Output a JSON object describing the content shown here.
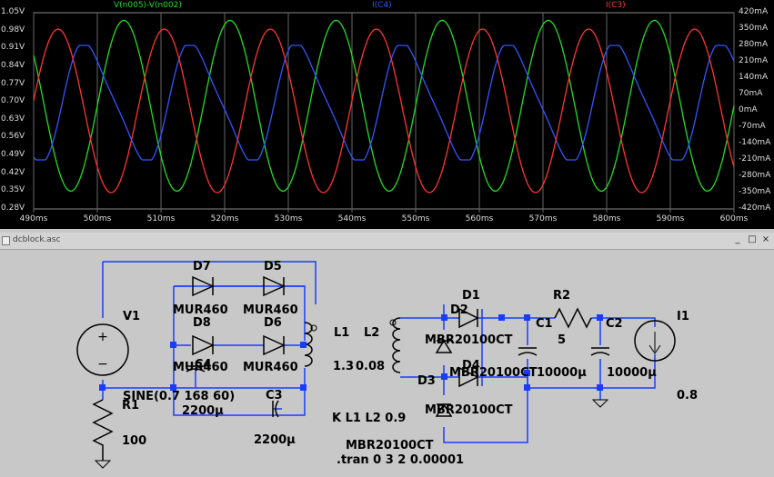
{
  "plot": {
    "traces": [
      {
        "label": "V(n005)-V(n002)",
        "color": "#22dd22"
      },
      {
        "label": "I(C4)",
        "color": "#3355ff"
      },
      {
        "label": "I(C3)",
        "color": "#ff3333"
      }
    ],
    "y_left_ticks": [
      "1.05V",
      "0.98V",
      "0.91V",
      "0.84V",
      "0.77V",
      "0.70V",
      "0.63V",
      "0.56V",
      "0.49V",
      "0.42V",
      "0.35V",
      "0.28V"
    ],
    "y_right_ticks": [
      "420mA",
      "350mA",
      "280mA",
      "210mA",
      "140mA",
      "70mA",
      "0mA",
      "-70mA",
      "-140mA",
      "-210mA",
      "-280mA",
      "-350mA",
      "-420mA"
    ],
    "x_ticks": [
      "490ms",
      "500ms",
      "510ms",
      "520ms",
      "530ms",
      "540ms",
      "550ms",
      "560ms",
      "570ms",
      "580ms",
      "590ms",
      "600ms"
    ]
  },
  "chart_data": {
    "type": "line",
    "x_range_ms": [
      490,
      600
    ],
    "ylim_left_V": [
      0.28,
      1.05
    ],
    "ylim_right_mA": [
      -420,
      420
    ],
    "frequency_hz": 60,
    "series": [
      {
        "name": "V(n005)-V(n002)",
        "axis": "left",
        "min": 0.35,
        "max": 1.02
      },
      {
        "name": "I(C4)",
        "axis": "right",
        "min": -210,
        "max": 280
      },
      {
        "name": "I(C3)",
        "axis": "right",
        "min": -350,
        "max": 350
      }
    ]
  },
  "schematic": {
    "title": "dcblock.asc",
    "window_buttons": [
      "_",
      "□",
      "×"
    ],
    "labels": {
      "v1": "V1",
      "v1_value": "SINE(0.7 168 60)",
      "r1": "R1",
      "r1_value": "100",
      "d7": "D7",
      "d7_model": "MUR460",
      "d5": "D5",
      "d5_model": "MUR460",
      "d8": "D8",
      "d8_model": "MUR460",
      "d6": "D6",
      "d6_model": "MUR460",
      "c4": "C4",
      "c4_value": "2200µ",
      "c3": "C3",
      "c3_value": "2200µ",
      "l1": "L1",
      "l1_value": "1.3",
      "l2": "L2",
      "l2_value": "0.08",
      "coupling": "K L1 L2 0.9",
      "d1": "D1",
      "d2": "D2",
      "d2_model": "MBR20100CT",
      "d3": "D3",
      "d4": "D4",
      "d4_model": "MBR20100CT",
      "d3_model": "MBR20100CT",
      "c1": "C1",
      "c1_value": "10000µ",
      "r2": "R2",
      "r2_value": "5",
      "c2": "C2",
      "c2_value": "10000µ",
      "i1": "I1",
      "i1_value": "0.8",
      "bottom_model": "MBR20100CT",
      "tran": ".tran 0 3 2 0.00001"
    }
  }
}
